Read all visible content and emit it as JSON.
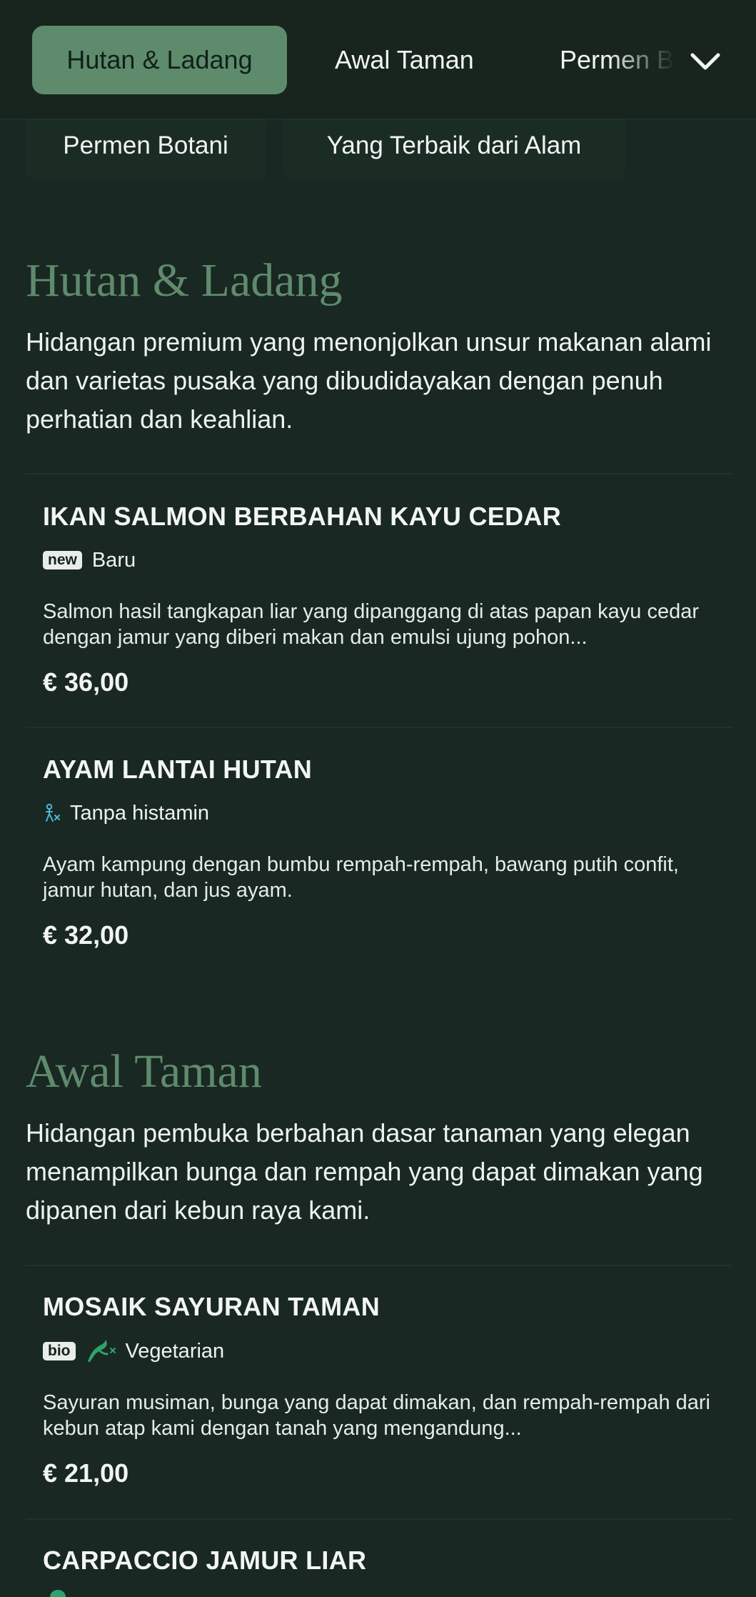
{
  "nav": {
    "tabs": [
      {
        "label": "Hutan & Ladang",
        "active": true
      },
      {
        "label": "Awal Taman",
        "active": false
      },
      {
        "label": "Permen Botani",
        "active": false
      }
    ],
    "secondary_tabs": [
      {
        "label": "Permen Botani"
      },
      {
        "label": "Yang Terbaik dari Alam"
      }
    ]
  },
  "sections": [
    {
      "title": "Hutan & Ladang",
      "description": "Hidangan premium yang menonjolkan unsur makanan alami dan varietas pusaka yang dibudidayakan dengan penuh perhatian dan keahlian.",
      "items": [
        {
          "name": "IKAN SALMON BERBAHAN KAYU CEDAR",
          "badge": "new",
          "tag": "Baru",
          "description": "Salmon hasil tangkapan liar yang dipanggang di atas papan kayu cedar dengan jamur yang diberi makan dan emulsi ujung pohon...",
          "price": "€ 36,00"
        },
        {
          "name": "AYAM LANTAI HUTAN",
          "tag_icon": "histamine-free-icon",
          "tag": "Tanpa histamin",
          "description": "Ayam kampung dengan bumbu rempah-rempah, bawang putih confit, jamur hutan, dan jus ayam.",
          "price": "€ 32,00"
        }
      ]
    },
    {
      "title": "Awal Taman",
      "description": "Hidangan pembuka berbahan dasar tanaman yang elegan menampilkan bunga dan rempah yang dapat dimakan yang dipanen dari kebun raya kami.",
      "items": [
        {
          "name": "MOSAIK SAYURAN TAMAN",
          "badge": "bio",
          "tag_icon": "vegetarian-icon",
          "tag": "Vegetarian",
          "description": "Sayuran musiman, bunga yang dapat dimakan, dan rempah-rempah dari kebun atap kami dengan tanah yang mengandung...",
          "price": "€ 21,00"
        },
        {
          "name": "CARPACCIO JAMUR LIAR"
        }
      ]
    }
  ],
  "colors": {
    "background": "#192822",
    "accent": "#5e8b6b",
    "section_title": "#5f8a6d"
  }
}
